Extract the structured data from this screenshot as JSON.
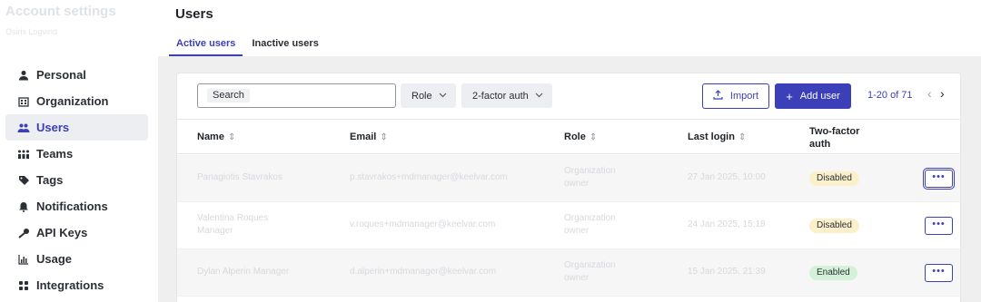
{
  "sidebar": {
    "title": "Account settings",
    "subtitle": "Osiris Logvind",
    "items": [
      {
        "label": "Personal",
        "icon": "person-icon",
        "glyph": "👤"
      },
      {
        "label": "Organization",
        "icon": "building-icon",
        "glyph": "▦"
      },
      {
        "label": "Users",
        "icon": "users-icon",
        "glyph": "👥"
      },
      {
        "label": "Teams",
        "icon": "team-icon",
        "glyph": "⚇"
      },
      {
        "label": "Tags",
        "icon": "tag-icon",
        "glyph": "⬥"
      },
      {
        "label": "Notifications",
        "icon": "bell-icon",
        "glyph": "🔔"
      },
      {
        "label": "API Keys",
        "icon": "key-icon",
        "glyph": "🔑"
      },
      {
        "label": "Usage",
        "icon": "chart-icon",
        "glyph": "▥"
      },
      {
        "label": "Integrations",
        "icon": "grid-icon",
        "glyph": "⊞"
      }
    ]
  },
  "main": {
    "title": "Users",
    "tabs": [
      {
        "label": "Active users",
        "active": true
      },
      {
        "label": "Inactive users",
        "active": false
      }
    ],
    "toolbar": {
      "search_placeholder": "Search",
      "role_filter": "Role",
      "twofa_filter": "2-factor auth",
      "import_label": "Import",
      "add_label": "Add user",
      "pagination": "1-20 of 71"
    },
    "table": {
      "columns": [
        "Name",
        "Email",
        "Role",
        "Last login",
        "Two-factor auth"
      ],
      "rows": [
        {
          "name": "Panagiotis Stavrakos",
          "email": "p.stavrakos+mdmanager@keelvar.com",
          "role": "Organization owner",
          "last_login": "27 Jan 2025, 10:00",
          "twofa": "Disabled"
        },
        {
          "name": "Valentina Roques Manager",
          "email": "v.roques+mdmanager@keelvar.com",
          "role": "Organization owner",
          "last_login": "24 Jan 2025, 15:18",
          "twofa": "Disabled"
        },
        {
          "name": "Dylan Alperin Manager",
          "email": "d.alperin+mdmanager@keelvar.com",
          "role": "Organization owner",
          "last_login": "15 Jan 2025, 21:39",
          "twofa": "Enabled"
        }
      ]
    }
  },
  "colors": {
    "accent": "#3b3fb8",
    "disabled_badge": "#fbf0c9",
    "enabled_badge": "#d4f2d8"
  }
}
